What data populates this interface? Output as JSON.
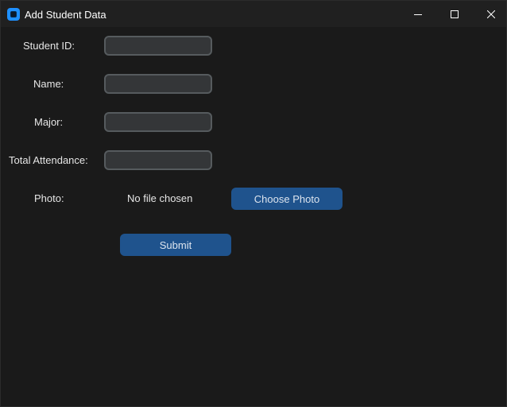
{
  "window": {
    "title": "Add Student Data"
  },
  "form": {
    "student_id_label": "Student ID:",
    "student_id_value": "",
    "name_label": "Name:",
    "name_value": "",
    "major_label": "Major:",
    "major_value": "",
    "attendance_label": "Total Attendance:",
    "attendance_value": "",
    "photo_label": "Photo:",
    "photo_status": "No file chosen",
    "choose_photo_label": "Choose Photo",
    "submit_label": "Submit"
  },
  "icons": {
    "app": "app-icon",
    "minimize": "minimize-icon",
    "maximize": "maximize-icon",
    "close": "close-icon"
  },
  "colors": {
    "background": "#1a1a1a",
    "titlebar": "#202020",
    "field_bg": "#343638",
    "field_border": "#565b5e",
    "button": "#1f538d",
    "text": "#e6e6e6"
  }
}
